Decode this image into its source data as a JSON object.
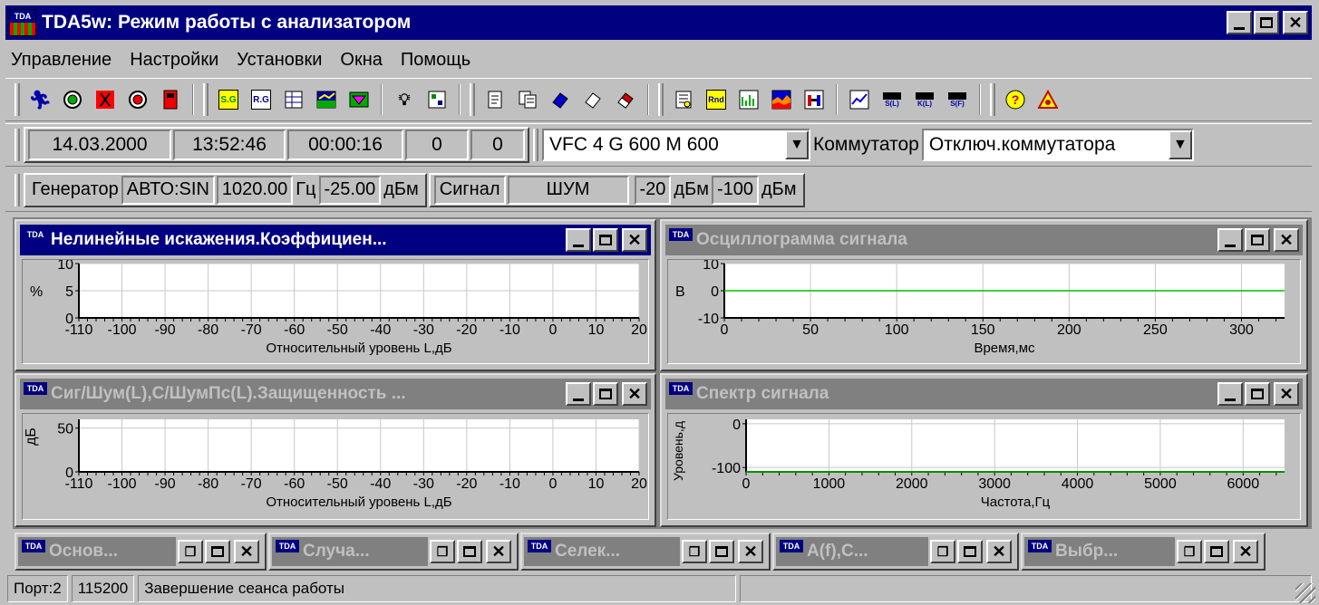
{
  "window": {
    "title": "TDA5w: Режим работы с анализатором",
    "icon_top": "TDA",
    "controls": [
      "minimize-icon",
      "maximize-icon",
      "close-icon"
    ]
  },
  "menu": [
    "Управление",
    "Настройки",
    "Установки",
    "Окна",
    "Помощь"
  ],
  "toolbar": {
    "groups": [
      [
        "run-man-icon",
        "target-green-icon",
        "stop-man-icon",
        "target-red-icon",
        "device-red-icon"
      ],
      [
        "sg-icon",
        "rg-icon",
        "table-edit-icon",
        "chart-image-icon",
        "filter-icon"
      ],
      [
        "lamp-icon",
        "calc-icon"
      ],
      [
        "doc-icon",
        "doc-copy-icon",
        "eraser-blue-icon",
        "eraser-white-icon",
        "eraser-red-icon"
      ],
      [
        "report-icon",
        "rnd-icon",
        "bar-chart-icon",
        "area-chart-icon",
        "h-chart-icon"
      ],
      [
        "line-chart-icon",
        "s-l-icon",
        "k-l-icon",
        "s-f-icon"
      ],
      [
        "help-icon",
        "warning-icon"
      ]
    ],
    "labels": {
      "sg": "S.G",
      "rg": "R.G",
      "rnd": "Rnd",
      "sl": "S(L)",
      "kl": "K(L)",
      "sf": "S(F)"
    }
  },
  "status1": {
    "date": "14.03.2000",
    "time": "13:52:46",
    "elapsed": "00:00:16",
    "count1": "0",
    "count2": "0",
    "device": "VFC 4 G 600 M 600",
    "commutator_label": "Коммутатор",
    "commutator_value": "Отключ.коммутатора"
  },
  "status2": {
    "gen_label": "Генератор",
    "gen_mode": "АВТО:SIN",
    "freq": "1020.00",
    "freq_unit": "Гц",
    "level": "-25.00",
    "level_unit": "дБм",
    "signal_label": "Сигнал",
    "signal_type": "ШУМ",
    "sig_level": "-20",
    "sig_level_unit": "дБм",
    "noise_level": "-100",
    "noise_unit": "дБм"
  },
  "windows": [
    {
      "title": "Нелинейные искажения.Коэффициен...",
      "active": true,
      "chart_data": {
        "type": "line",
        "ylabel": "%",
        "xlabel": "Относительный уровень L,дБ",
        "yticks": [
          "10",
          "5",
          "0"
        ],
        "xticks": [
          "-110",
          "-100",
          "-90",
          "-80",
          "-70",
          "-60",
          "-50",
          "-40",
          "-30",
          "-20",
          "-10",
          "0",
          "10",
          "20"
        ],
        "xlim": [
          -110,
          20
        ],
        "ylim": [
          0,
          10
        ],
        "grid": true,
        "series": []
      }
    },
    {
      "title": "Осциллограмма сигнала",
      "active": false,
      "chart_data": {
        "type": "line",
        "ylabel": "В",
        "xlabel": "Время,мс",
        "yticks": [
          "10",
          "0",
          "-10"
        ],
        "xticks": [
          "0",
          "50",
          "100",
          "150",
          "200",
          "250",
          "300"
        ],
        "xlim": [
          0,
          325
        ],
        "ylim": [
          -10,
          10
        ],
        "grid": true,
        "series": [
          {
            "x": [
              0,
              325
            ],
            "y": [
              0,
              0
            ],
            "color": "#00c000"
          }
        ]
      }
    },
    {
      "title": "Сиг/Шум(L),С/ШумПс(L).Защищенность ...",
      "active": false,
      "chart_data": {
        "type": "line",
        "ylabel": "дБ",
        "xlabel": "Относительный уровень L,дБ",
        "yticks": [
          "50",
          "0"
        ],
        "xticks": [
          "-110",
          "-100",
          "-90",
          "-80",
          "-70",
          "-60",
          "-50",
          "-40",
          "-30",
          "-20",
          "-10",
          "0",
          "10",
          "20"
        ],
        "xlim": [
          -110,
          20
        ],
        "ylim": [
          0,
          60
        ],
        "grid": true,
        "series": []
      }
    },
    {
      "title": "Спектр сигнала",
      "active": false,
      "chart_data": {
        "type": "line",
        "ylabel": "Уровень,д",
        "xlabel": "Частота,Гц",
        "yticks": [
          "0",
          "-100"
        ],
        "xticks": [
          "0",
          "1000",
          "2000",
          "3000",
          "4000",
          "5000",
          "6000"
        ],
        "xlim": [
          0,
          6500
        ],
        "ylim": [
          -110,
          10
        ],
        "grid": true,
        "series": [
          {
            "x": [
              0,
              6500
            ],
            "y": [
              -110,
              -110
            ],
            "color": "#00c000"
          }
        ]
      }
    }
  ],
  "minimized": [
    "Основ...",
    "Случа...",
    "Селек...",
    "A(f),C...",
    "Выбр..."
  ],
  "statusbar": {
    "port": "Порт:2",
    "baud": "115200",
    "message": "Завершение сеанса работы"
  }
}
